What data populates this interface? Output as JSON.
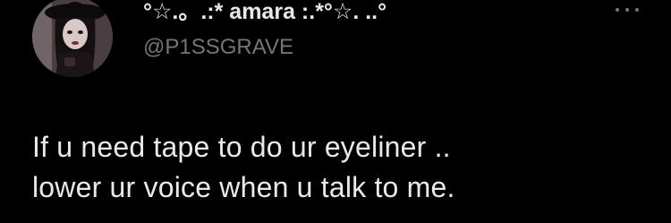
{
  "tweet": {
    "author": {
      "display_name": "°☆.。.:* amara :.*°☆. ..°",
      "handle": "@P1SSGRAVE",
      "avatar_icon": "profile-photo"
    },
    "more_icon": "more-horizontal-icon",
    "text_lines": [
      "If u need tape to do ur eyeliner ..",
      "lower ur voice when u talk to me."
    ]
  },
  "colors": {
    "background": "#000000",
    "primary_text": "#e7e9ea",
    "secondary_text": "#71767b"
  }
}
